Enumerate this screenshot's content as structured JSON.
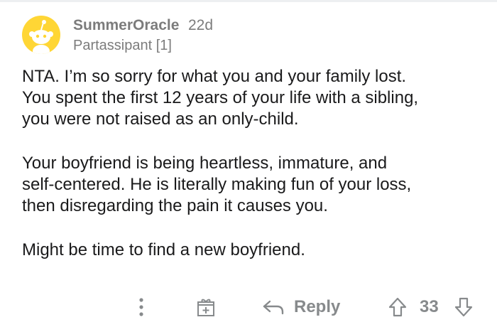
{
  "comment": {
    "author": "SummerOracle",
    "time_ago": "22d",
    "flair": "Partassipant [1]",
    "paragraphs": [
      "NTA. I’m so sorry for what you and your family lost.\nYou spent the first 12 years of your life with a sibling,\nyou were not raised as an only-child.",
      "Your boyfriend is being heartless, immature, and\nself-centered. He is literally making fun of your loss,\nthen disregarding the pain it causes you.",
      "Might be time to find a new boyfriend."
    ]
  },
  "actions": {
    "more_icon": "more-vertical-icon",
    "award_icon": "gift-icon",
    "reply_icon": "reply-arrow-icon",
    "reply_label": "Reply",
    "upvote_icon": "upvote-arrow-icon",
    "score": "33",
    "downvote_icon": "downvote-arrow-icon"
  },
  "colors": {
    "avatar_bg": "#ffd635",
    "meta_text": "#7c7c7c",
    "body_text": "#1a1a1b",
    "action_gray": "#878a8c"
  }
}
